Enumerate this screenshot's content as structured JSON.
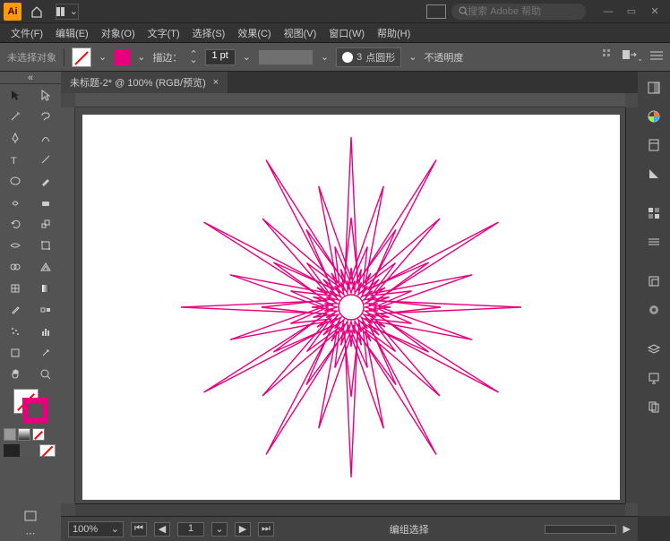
{
  "app": {
    "logo": "Ai"
  },
  "search": {
    "placeholder": "搜索 Adobe 帮助"
  },
  "menu": {
    "file": "文件(F)",
    "edit": "编辑(E)",
    "object": "对象(O)",
    "type": "文字(T)",
    "select": "选择(S)",
    "effect": "效果(C)",
    "view": "视图(V)",
    "window": "窗口(W)",
    "help": "帮助(H)"
  },
  "options": {
    "noSelection": "未选择对象",
    "strokeLabel": "描边：",
    "strokeWeight": "1 pt",
    "profileBullet": "●",
    "dashCount": "3",
    "dashStyle": "点圆形",
    "opacityLabel": "不透明度"
  },
  "document": {
    "tabTitle": "未标题-2* @ 100% (RGB/预览)",
    "close": "×"
  },
  "status": {
    "zoom": "100%",
    "artboard": "1",
    "mode": "编组选择"
  },
  "colors": {
    "pink": "#e6007e"
  }
}
